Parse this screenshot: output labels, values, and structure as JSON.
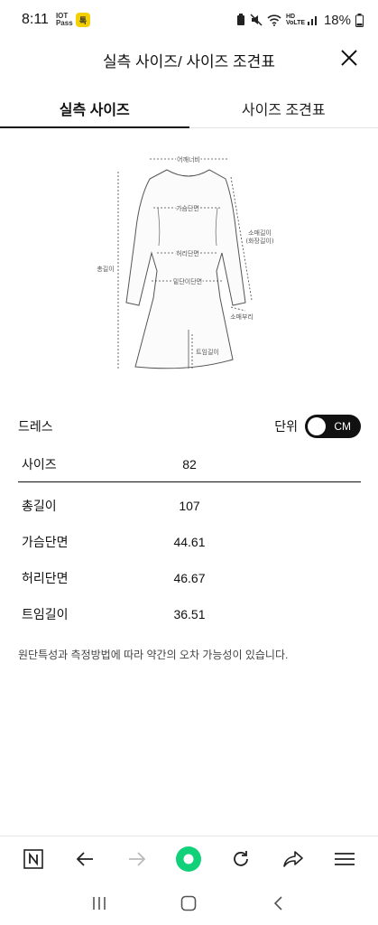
{
  "status_bar": {
    "time": "8:11",
    "sim_badge": "IOT Pass",
    "kakao_badge": "톡",
    "network": "HD VoLTE",
    "battery": "18%"
  },
  "header": {
    "title": "실측 사이즈/ 사이즈 조견표",
    "close_icon": "close-icon"
  },
  "tabs": [
    {
      "label": "실측 사이즈",
      "active": true
    },
    {
      "label": "사이즈 조견표",
      "active": false
    }
  ],
  "diagram": {
    "shoulder": "어깨너비",
    "chest": "가슴단면",
    "waist": "허리단면",
    "hem": "밑단이단면",
    "total_length": "총길이",
    "sleeve_length": "소매길이",
    "sleeve_length_note": "(화장길이)",
    "sleeve_cuff": "소매부리",
    "slit_length": "트임길이"
  },
  "product": {
    "name": "드레스",
    "unit_label": "단위",
    "unit_value": "CM"
  },
  "table": {
    "header": {
      "label": "사이즈",
      "value": "82"
    },
    "rows": [
      {
        "label": "총길이",
        "value": "107"
      },
      {
        "label": "가슴단면",
        "value": "44.61"
      },
      {
        "label": "허리단면",
        "value": "46.67"
      },
      {
        "label": "트임길이",
        "value": "36.51"
      }
    ]
  },
  "note": "원단특성과 측정방법에 따라 약간의 오차 가능성이 있습니다.",
  "browser_toolbar": [
    "naver-icon",
    "back-icon",
    "forward-icon",
    "home-dot-icon",
    "refresh-icon",
    "share-icon",
    "menu-icon"
  ],
  "system_nav": [
    "recents-icon",
    "home-icon",
    "back-icon"
  ]
}
